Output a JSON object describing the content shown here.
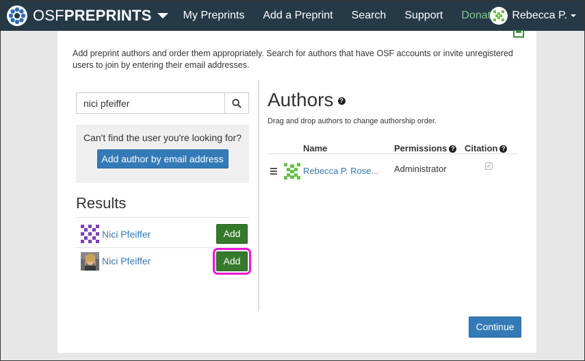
{
  "navbar": {
    "brand_light": "OSF",
    "brand_bold": "PREPRINTS",
    "items": [
      {
        "label": "My Preprints"
      },
      {
        "label": "Add a Preprint"
      },
      {
        "label": "Search"
      },
      {
        "label": "Support"
      },
      {
        "label": "Donate"
      }
    ],
    "user_name": "Rebecca P.",
    "donate_color": "#7ccc83",
    "background": "#263947"
  },
  "intro": {
    "text": "Add preprint authors and order them appropriately. Search for authors that have OSF accounts or invite unregistered users to join by entering their email addresses."
  },
  "search": {
    "value": "nici pfeiffer",
    "icon": "search-icon"
  },
  "not_found": {
    "text": "Can't find the user you're looking for?",
    "button_label": "Add author by email address"
  },
  "results": {
    "title": "Results",
    "items": [
      {
        "name": "Nici Pfeiffer",
        "button_label": "Add"
      },
      {
        "name": "Nici Pfeiffer",
        "button_label": "Add"
      }
    ]
  },
  "authors": {
    "title": "Authors",
    "hint": "Drag and drop authors to change authorship order.",
    "columns": {
      "name": "Name",
      "permissions": "Permissions",
      "citation": "Citation"
    },
    "rows": [
      {
        "name": "Rebecca P. Rose...",
        "permission": "Administrator",
        "citation": true
      }
    ]
  },
  "continue_label": "Continue",
  "colors": {
    "primary": "#337ab7",
    "add_green": "#357a2c",
    "highlight": "#ec13d8"
  }
}
